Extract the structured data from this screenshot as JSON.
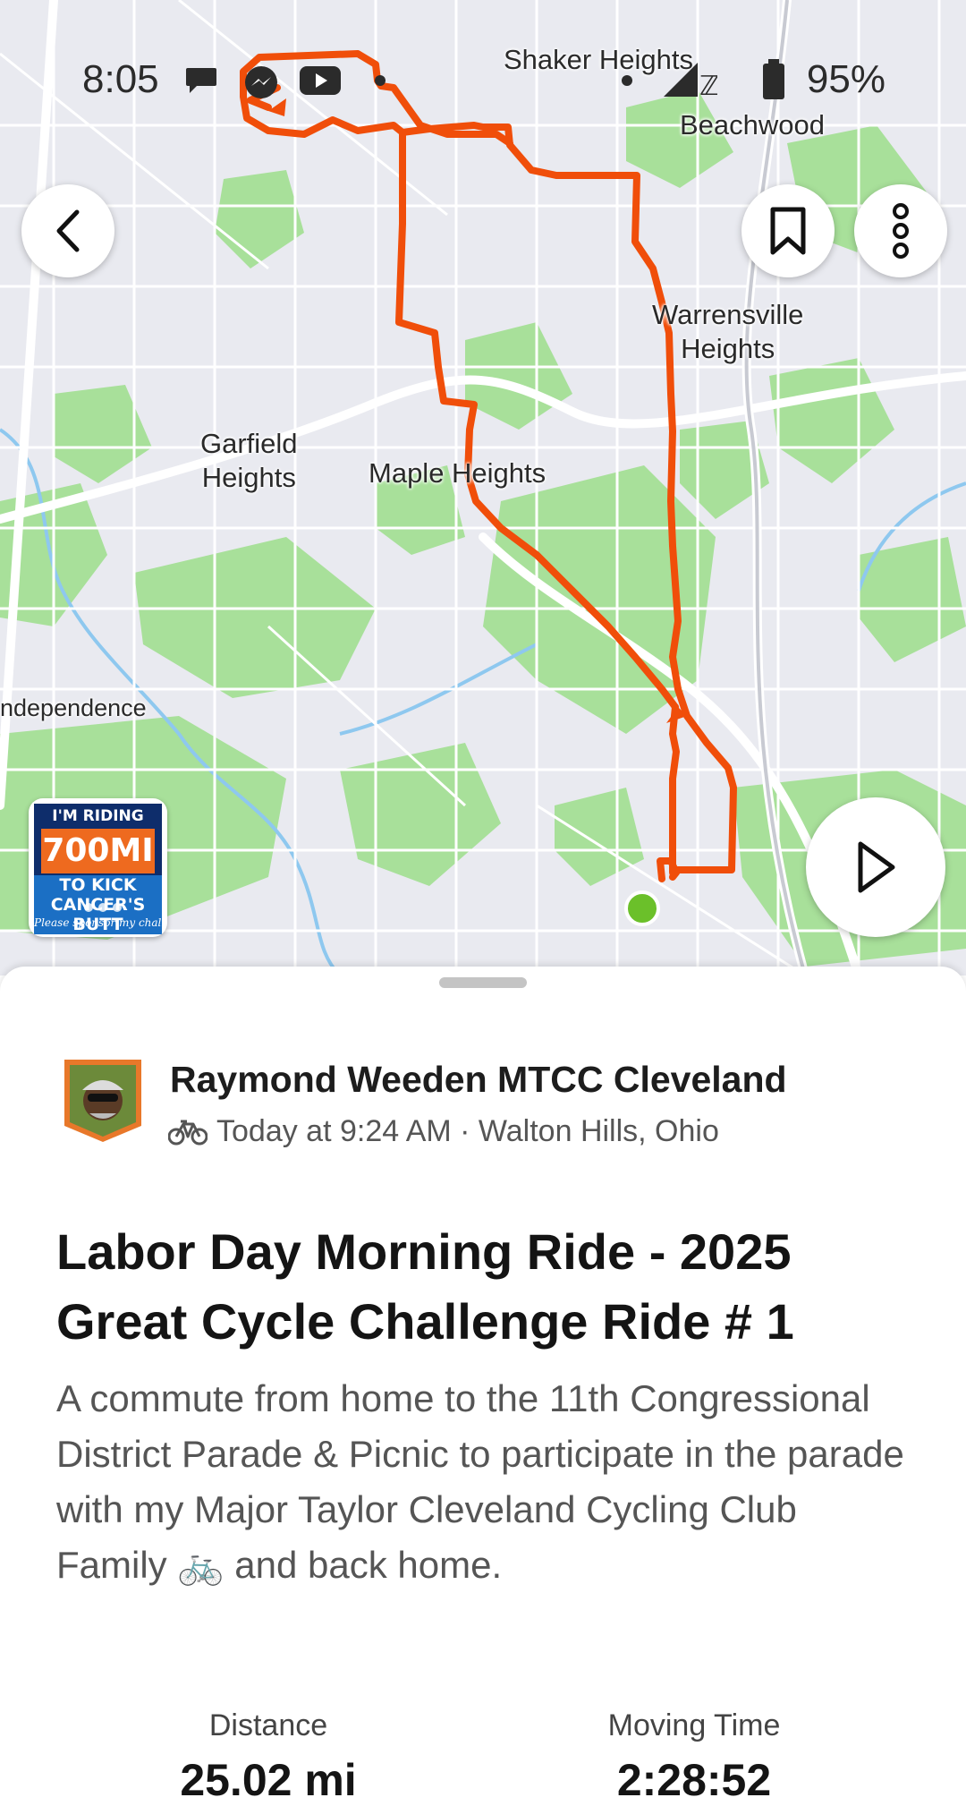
{
  "status_bar": {
    "time": "8:05",
    "battery": "95%",
    "icons": [
      "chat-bubble-icon",
      "messenger-icon",
      "youtube-icon",
      "dot-icon",
      "signal-icon",
      "battery-icon"
    ]
  },
  "map": {
    "labels": {
      "shaker_heights": "Shaker Heights",
      "beachwood": "Beachwood",
      "warrensville": "Warrensville\nHeights",
      "garfield": "Garfield\nHeights",
      "maple": "Maple Heights",
      "independence": "ndependence"
    },
    "route_color": "#f04e0a",
    "start_color": "#6bc02a"
  },
  "promo": {
    "line1": "I'M RIDING",
    "line2": "700MI",
    "line3": "TO KICK",
    "line4": "CANCER'S BUTT",
    "line5": "Please sponsor my challenge"
  },
  "activity": {
    "athlete": "Raymond Weeden MTCC Cleveland",
    "meta": "Today at 9:24 AM · Walton Hills, Ohio",
    "title": "Labor Day Morning Ride - 2025 Great Cycle Challenge Ride # 1",
    "description": "A commute from home to the 11th Congressional District Parade & Picnic to participate in the parade with my Major Taylor Cleveland Cycling Club Family 🚲 and back home."
  },
  "stats": [
    {
      "label": "Distance",
      "value": "25.02 mi"
    },
    {
      "label": "Moving Time",
      "value": "2:28:52"
    }
  ],
  "colors": {
    "map_bg": "#e9eaf0",
    "park": "#9fdc8f",
    "road": "#ffffff"
  }
}
